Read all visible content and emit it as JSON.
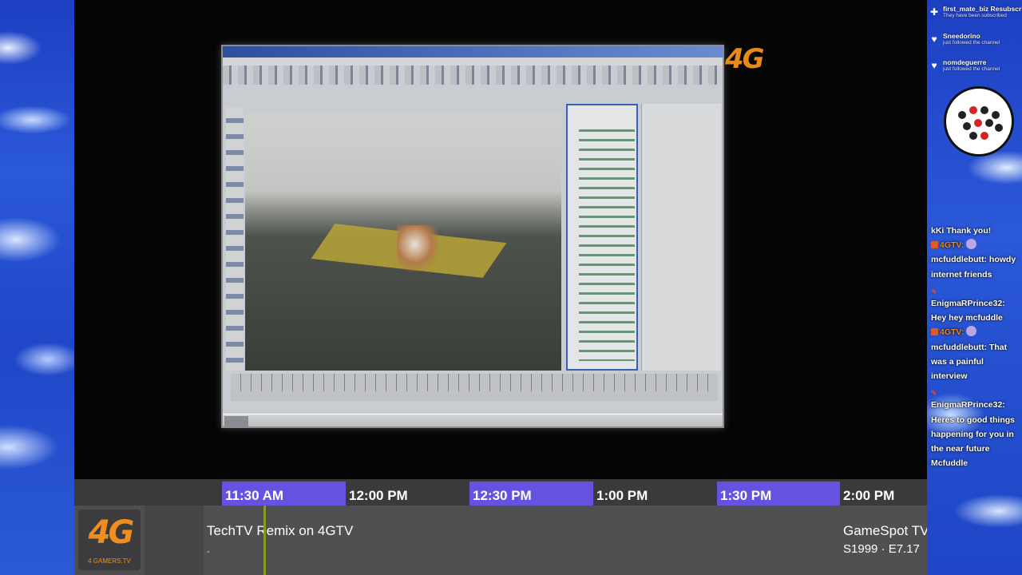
{
  "brand": {
    "bug_logo": "4G",
    "logo_text": "4G",
    "logo_subtext": "4 GAMERS.TV",
    "accent_color": "#ef8e1e"
  },
  "chat": {
    "alerts": [
      {
        "icon": "plus-icon",
        "name": "first_mate_biz Resubscribed",
        "sub": "They have been subscribed"
      },
      {
        "icon": "heart-icon",
        "name": "Sneedorino",
        "sub": "just followed the channel"
      },
      {
        "icon": "heart-icon",
        "name": "nomdeguerre",
        "sub": "just followed the channel"
      }
    ],
    "messages": [
      {
        "prefix": "",
        "user": "",
        "text": "kKi Thank you!"
      },
      {
        "prefix": "4GTV:",
        "user": "",
        "text": ""
      },
      {
        "prefix": "",
        "user": "mcfuddlebutt:",
        "text": "howdy internet friends"
      },
      {
        "prefix": "",
        "user": "EnigmaRPrince32:",
        "text": "Hey hey mcfuddle"
      },
      {
        "prefix": "4GTV:",
        "user": "",
        "text": ""
      },
      {
        "prefix": "",
        "user": "mcfuddlebutt:",
        "text": "That was a painful interview"
      },
      {
        "prefix": "",
        "user": "EnigmaRPrince32:",
        "text": "Heres to good things happening for you in the near future Mcfuddle"
      }
    ]
  },
  "schedule": {
    "times": [
      "11:30 AM",
      "12:00 PM",
      "12:30 PM",
      "1:00 PM",
      "1:30 PM",
      "2:00 PM"
    ],
    "current": {
      "title": "TechTV Remix on 4GTV",
      "subtitle": "-"
    },
    "next": {
      "title": "GameSpot TV",
      "subtitle": "S1999 · E7.17"
    },
    "colors": {
      "highlight": "#6552e0",
      "row": "#505052"
    }
  }
}
